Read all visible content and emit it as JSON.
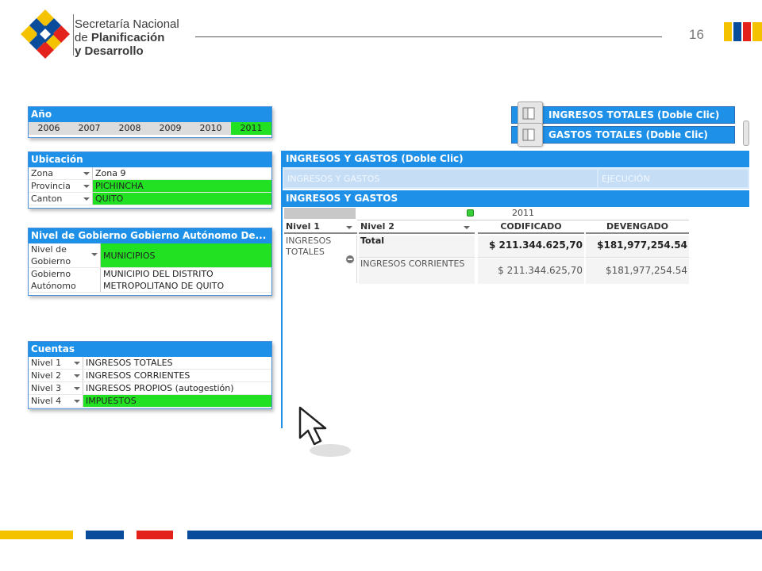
{
  "header": {
    "org_line1": "Secretaría Nacional",
    "org_line2_prefix": "de ",
    "org_line2_bold": "Planificación",
    "org_line3": "y Desarrollo",
    "page_number": "16"
  },
  "colors": {
    "brand_yellow": "#f5c200",
    "brand_blue": "#0a4c9c",
    "brand_red": "#e3231b",
    "panel_blue": "#1e90e8",
    "selected_green": "#22e022"
  },
  "anio": {
    "title": "Año",
    "years": [
      "2006",
      "2007",
      "2008",
      "2009",
      "2010",
      "2011"
    ],
    "selected": "2011"
  },
  "ubicacion": {
    "title": "Ubicación",
    "rows": [
      {
        "key": "Zona",
        "value": "Zona 9"
      },
      {
        "key": "Provincia",
        "value": "PICHINCHA"
      },
      {
        "key": "Canton",
        "value": "QUITO"
      }
    ]
  },
  "nivel_gobierno": {
    "title": "Nivel de Gobierno Gobierno Autónomo De...",
    "row1_key_a": "Nivel de",
    "row1_key_b": "Gobierno",
    "row1_value": "MUNICIPIOS",
    "row2_key_a": "Gobierno",
    "row2_key_b": "Autónomo",
    "row2_value_a": "MUNICIPIO DEL DISTRITO",
    "row2_value_b": "METROPOLITANO DE QUITO"
  },
  "cuentas": {
    "title": "Cuentas",
    "rows": [
      {
        "key": "Nivel 1",
        "value": "INGRESOS TOTALES"
      },
      {
        "key": "Nivel 2",
        "value": "INGRESOS CORRIENTES"
      },
      {
        "key": "Nivel 3",
        "value": "INGRESOS PROPIOS (autogestión)"
      },
      {
        "key": "Nivel 4",
        "value": "IMPUESTOS"
      }
    ]
  },
  "buttons": {
    "ingresos": "INGRESOS TOTALES (Doble Clic)",
    "gastos": "GASTOS TOTALES (Doble Clic)"
  },
  "main": {
    "title": "INGRESOS Y GASTOS (Doble Clic)",
    "tab1": "INGRESOS Y GASTOS",
    "tab2": "EJECUCIÓN",
    "subtitle": "INGRESOS Y GASTOS",
    "year_header": "2011",
    "col_nivel1": "Nivel 1",
    "col_nivel2": "Nivel 2",
    "col_codificado": "CODIFICADO",
    "col_devengado": "DEVENGADO",
    "nivel1_a": "INGRESOS",
    "nivel1_b": "TOTALES",
    "row_total_label": "Total",
    "row_total_cod": "$ 211.344.625,70",
    "row_total_dev": "$181,977,254.54",
    "row2_label": "INGRESOS CORRIENTES",
    "row2_cod": "$ 211.344.625,70",
    "row2_dev": "$181,977,254.54"
  }
}
